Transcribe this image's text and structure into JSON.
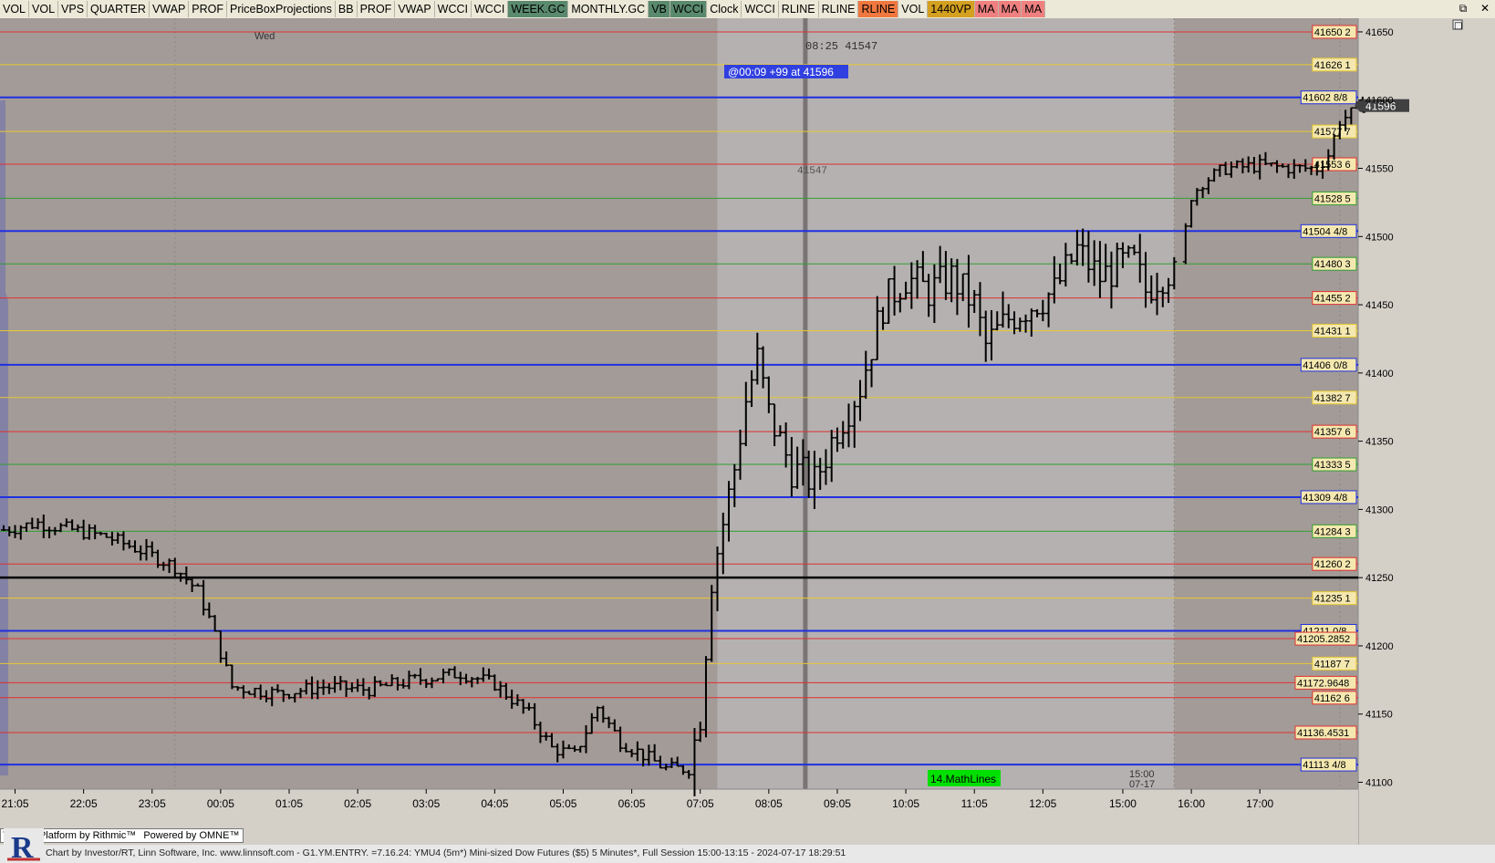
{
  "toolbar": {
    "buttons": [
      {
        "label": "VOL",
        "bg": "#ece9d8",
        "fg": "#000"
      },
      {
        "label": "VOL",
        "bg": "#ece9d8",
        "fg": "#000"
      },
      {
        "label": "VPS",
        "bg": "#ece9d8",
        "fg": "#000"
      },
      {
        "label": "QUARTER",
        "bg": "#ece9d8",
        "fg": "#000"
      },
      {
        "label": "VWAP",
        "bg": "#ece9d8",
        "fg": "#000"
      },
      {
        "label": "PROF",
        "bg": "#ece9d8",
        "fg": "#000"
      },
      {
        "label": "PriceBoxProjections",
        "bg": "#ece9d8",
        "fg": "#000"
      },
      {
        "label": "BB",
        "bg": "#ece9d8",
        "fg": "#000"
      },
      {
        "label": "PROF",
        "bg": "#ece9d8",
        "fg": "#000"
      },
      {
        "label": "VWAP",
        "bg": "#ece9d8",
        "fg": "#000"
      },
      {
        "label": "WCCI",
        "bg": "#ece9d8",
        "fg": "#000"
      },
      {
        "label": "WCCI",
        "bg": "#ece9d8",
        "fg": "#000"
      },
      {
        "label": "WEEK.GC",
        "bg": "#5a8a6e",
        "fg": "#000"
      },
      {
        "label": "MONTHLY.GC",
        "bg": "#ece9d8",
        "fg": "#000"
      },
      {
        "label": "VB",
        "bg": "#5a8a6e",
        "fg": "#000"
      },
      {
        "label": "WCCI",
        "bg": "#5a8a6e",
        "fg": "#000"
      },
      {
        "label": "Clock",
        "bg": "#ece9d8",
        "fg": "#000"
      },
      {
        "label": "WCCI",
        "bg": "#ece9d8",
        "fg": "#000"
      },
      {
        "label": "RLINE",
        "bg": "#ece9d8",
        "fg": "#000"
      },
      {
        "label": "RLINE",
        "bg": "#ece9d8",
        "fg": "#000"
      },
      {
        "label": "RLINE",
        "bg": "#f07840",
        "fg": "#000"
      },
      {
        "label": "VOL",
        "bg": "#ece9d8",
        "fg": "#000"
      },
      {
        "label": "1440VP",
        "bg": "#d4a020",
        "fg": "#000"
      },
      {
        "label": "MA",
        "bg": "#f08080",
        "fg": "#000"
      },
      {
        "label": "MA",
        "bg": "#f08080",
        "fg": "#000"
      },
      {
        "label": "MA",
        "bg": "#f08080",
        "fg": "#000"
      }
    ],
    "window_controls": [
      "⧉",
      "✕"
    ],
    "small_button": "□"
  },
  "chart_data": {
    "type": "candlestick",
    "instrument": "YMU4 (5m*) Mini-sized Dow Futures ($5) 5 Minutes*",
    "ylim": [
      41095,
      41660
    ],
    "y_ticks": [
      41100,
      41150,
      41200,
      41250,
      41300,
      41350,
      41400,
      41450,
      41500,
      41550,
      41600,
      41650
    ],
    "x_ticks": [
      {
        "label": "21:05",
        "bar": 2
      },
      {
        "label": "22:05",
        "bar": 14
      },
      {
        "label": "23:05",
        "bar": 26
      },
      {
        "label": "00:05",
        "bar": 38
      },
      {
        "label": "01:05",
        "bar": 50
      },
      {
        "label": "02:05",
        "bar": 62
      },
      {
        "label": "03:05",
        "bar": 74
      },
      {
        "label": "04:05",
        "bar": 86
      },
      {
        "label": "05:05",
        "bar": 98
      },
      {
        "label": "06:05",
        "bar": 110
      },
      {
        "label": "07:05",
        "bar": 122
      },
      {
        "label": "08:05",
        "bar": 134
      },
      {
        "label": "09:05",
        "bar": 146
      },
      {
        "label": "10:05",
        "bar": 158
      },
      {
        "label": "11:05",
        "bar": 170
      },
      {
        "label": "12:05",
        "bar": 182
      },
      {
        "label": "15:00",
        "bar": 196
      },
      {
        "label": "16:00",
        "bar": 208
      },
      {
        "label": "17:00",
        "bar": 220
      }
    ],
    "session_shading": [
      {
        "from_bar": 0,
        "to_bar": 125,
        "color": "#a39b97"
      },
      {
        "from_bar": 125,
        "to_bar": 205,
        "color": "#b5b1b1"
      },
      {
        "from_bar": 205,
        "to_bar": 238,
        "color": "#a39b97"
      }
    ],
    "anchor_prices": [
      [
        0,
        41285
      ],
      [
        6,
        41290
      ],
      [
        12,
        41285
      ],
      [
        18,
        41280
      ],
      [
        24,
        41270
      ],
      [
        30,
        41258
      ],
      [
        34,
        41240
      ],
      [
        36,
        41220
      ],
      [
        40,
        41170
      ],
      [
        48,
        41165
      ],
      [
        56,
        41170
      ],
      [
        64,
        41168
      ],
      [
        72,
        41175
      ],
      [
        80,
        41180
      ],
      [
        86,
        41172
      ],
      [
        92,
        41150
      ],
      [
        96,
        41125
      ],
      [
        100,
        41120
      ],
      [
        104,
        41155
      ],
      [
        108,
        41130
      ],
      [
        112,
        41120
      ],
      [
        116,
        41110
      ],
      [
        120,
        41110
      ],
      [
        122,
        41150
      ],
      [
        124,
        41250
      ],
      [
        126,
        41290
      ],
      [
        128,
        41330
      ],
      [
        130,
        41380
      ],
      [
        132,
        41410
      ],
      [
        134,
        41370
      ],
      [
        138,
        41330
      ],
      [
        142,
        41320
      ],
      [
        146,
        41360
      ],
      [
        150,
        41390
      ],
      [
        152,
        41420
      ],
      [
        154,
        41450
      ],
      [
        158,
        41470
      ],
      [
        162,
        41460
      ],
      [
        166,
        41470
      ],
      [
        170,
        41450
      ],
      [
        172,
        41420
      ],
      [
        176,
        41440
      ],
      [
        180,
        41450
      ],
      [
        184,
        41460
      ],
      [
        188,
        41490
      ],
      [
        192,
        41470
      ],
      [
        196,
        41480
      ],
      [
        198,
        41480
      ],
      [
        200,
        41460
      ],
      [
        202,
        41470
      ],
      [
        204,
        41475
      ],
      [
        206,
        41480
      ],
      [
        208,
        41530
      ],
      [
        210,
        41540
      ],
      [
        214,
        41550
      ],
      [
        220,
        41552
      ],
      [
        226,
        41550
      ],
      [
        230,
        41550
      ],
      [
        232,
        41560
      ],
      [
        234,
        41585
      ],
      [
        236,
        41590
      ],
      [
        238,
        41596
      ]
    ],
    "price_levels": [
      {
        "price": 41650,
        "label": "41650 2",
        "color": "#e03030"
      },
      {
        "price": 41626,
        "label": "41626 1",
        "color": "#e8c830"
      },
      {
        "price": 41602,
        "label": "41602 8/8",
        "color": "#2030e0"
      },
      {
        "price": 41577,
        "label": "41577 7",
        "color": "#e8c830"
      },
      {
        "price": 41553,
        "label": "41553 6",
        "color": "#e03030"
      },
      {
        "price": 41528,
        "label": "41528 5",
        "color": "#30a030"
      },
      {
        "price": 41504,
        "label": "41504 4/8",
        "color": "#2030e0"
      },
      {
        "price": 41480,
        "label": "41480 3",
        "color": "#30a030"
      },
      {
        "price": 41455,
        "label": "41455 2",
        "color": "#e03030"
      },
      {
        "price": 41431,
        "label": "41431 1",
        "color": "#e8c830"
      },
      {
        "price": 41406,
        "label": "41406 0/8",
        "color": "#2030e0"
      },
      {
        "price": 41382,
        "label": "41382 7",
        "color": "#e8c830"
      },
      {
        "price": 41357,
        "label": "41357 6",
        "color": "#e03030"
      },
      {
        "price": 41333,
        "label": "41333 5",
        "color": "#30a030"
      },
      {
        "price": 41309,
        "label": "41309 4/8",
        "color": "#2030e0"
      },
      {
        "price": 41284,
        "label": "41284 3",
        "color": "#30a030"
      },
      {
        "price": 41260,
        "label": "41260 2",
        "color": "#e03030"
      },
      {
        "price": 41235,
        "label": "41235 1",
        "color": "#e8c830"
      },
      {
        "price": 41211,
        "label": "41211 0/8",
        "color": "#2030e0"
      },
      {
        "price": 41205.2852,
        "label": "41205.2852",
        "color": "#e03030"
      },
      {
        "price": 41187,
        "label": "41187 7",
        "color": "#e8c830"
      },
      {
        "price": 41172.9648,
        "label": "41172.9648",
        "color": "#e03030"
      },
      {
        "price": 41162,
        "label": "41162 6",
        "color": "#e03030"
      },
      {
        "price": 41136.4531,
        "label": "41136.4531",
        "color": "#e03030"
      },
      {
        "price": 41113,
        "label": "41113 4/8",
        "color": "#2030e0"
      }
    ],
    "black_line_price": 41250,
    "last_price": 41596,
    "last_price_label": "41596",
    "annotations": {
      "day_label": "Wed",
      "clock_text": "08:25  41547",
      "gain_text": "@00:09  +99 at 41596",
      "faint_price": "41547",
      "mathlines_label": "14.MathLines",
      "session_time": "15:00",
      "session_date": "07-17"
    }
  },
  "colors": {
    "chart_dark": "#a39b97",
    "chart_light": "#b5b1b1",
    "axis_bg": "#d4d0c8",
    "bar_color": "#000000",
    "mathlines_bg": "#00e000"
  },
  "rithmic_bar": {
    "left": "Trading Platform by Rithmic™",
    "right": "Powered by OMNE™"
  },
  "status_text": "Chart by Investor/RT, Linn Software, Inc. www.linnsoft.com - G1.YM.ENTRY.  =7.16.24: YMU4 (5m*) Mini-sized Dow Futures ($5) 5 Minutes*, Full Session 15:00-13:15 - 2024-07-17 18:29:51"
}
